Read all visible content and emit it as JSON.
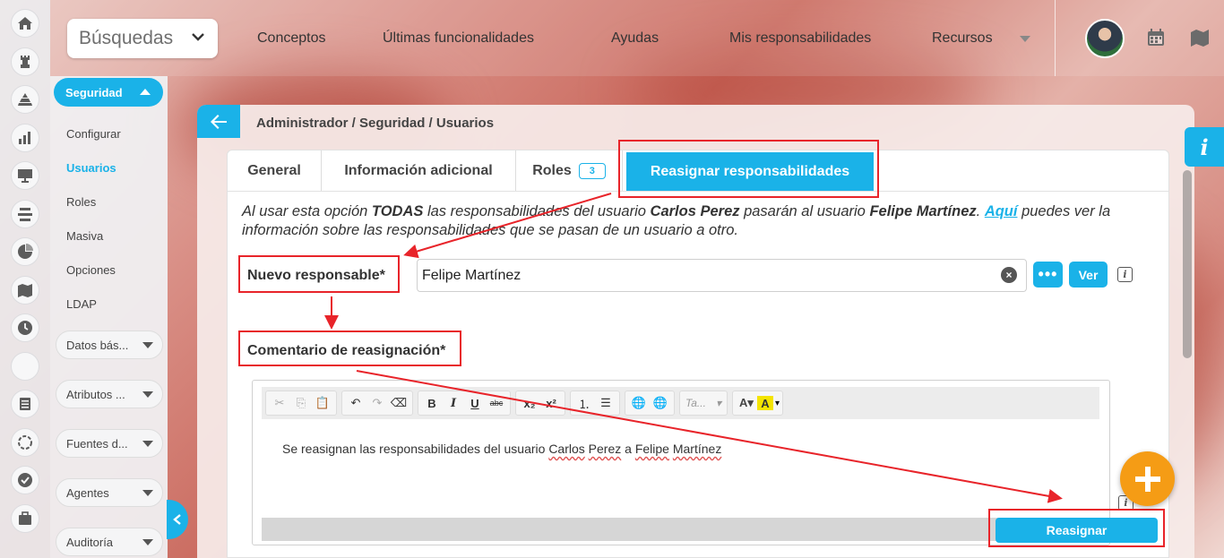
{
  "topbar": {
    "search_label": "Búsquedas",
    "nav": [
      "Conceptos",
      "Últimas funcionalidades",
      "Ayudas",
      "Mis responsabilidades",
      "Recursos"
    ]
  },
  "rail_icons": [
    "home-icon",
    "chess-rook-icon",
    "pyramid-icon",
    "bar-chart-icon",
    "presentation-icon",
    "align-icon",
    "pie-chart-icon",
    "map-icon",
    "clock-icon",
    "blank-icon",
    "list-icon",
    "circle-dashed-icon",
    "check-circle-icon",
    "briefcase-icon"
  ],
  "side_menu": {
    "module": "Seguridad",
    "links": [
      "Configurar",
      "Usuarios",
      "Roles",
      "Masiva",
      "Opciones",
      "LDAP"
    ],
    "groups": [
      "Datos bás...",
      "Atributos ...",
      "Fuentes d...",
      "Agentes",
      "Auditoría"
    ]
  },
  "breadcrumb": "Administrador / Seguridad / Usuarios",
  "tabs": {
    "general": "General",
    "info": "Información adicional",
    "roles": "Roles",
    "roles_count": "3",
    "reassign": "Reasignar responsabilidades"
  },
  "description": {
    "p1": "Al usar esta opción ",
    "b1": "TODAS",
    "p2": " las responsabilidades del usuario ",
    "b2": "Carlos Perez",
    "p3": " pasarán al usuario ",
    "b3": "Felipe Martínez",
    "p4": ". ",
    "link": "Aquí",
    "p5": " puedes ver la información sobre las responsabilidades que se pasan de un usuario a otro."
  },
  "form": {
    "new_label": "Nuevo responsable*",
    "new_value": "Felipe Martínez",
    "clear": "×",
    "more": "•••",
    "ver": "Ver",
    "info": "i",
    "comment_label": "Comentario de reasignación*"
  },
  "editor": {
    "font_select": "Ta...",
    "t1": "Se reasignan las responsabilidades del usuario ",
    "s1": "Carlos",
    "t2": " ",
    "s2": "Perez",
    "t3": " a ",
    "s3": "Felipe",
    "t4": " ",
    "s4": "Martínez"
  },
  "reassign_button": "Reasignar",
  "colors": {
    "accent": "#1ab2e8",
    "annotation": "#e8242a",
    "fab": "#f59c15"
  }
}
